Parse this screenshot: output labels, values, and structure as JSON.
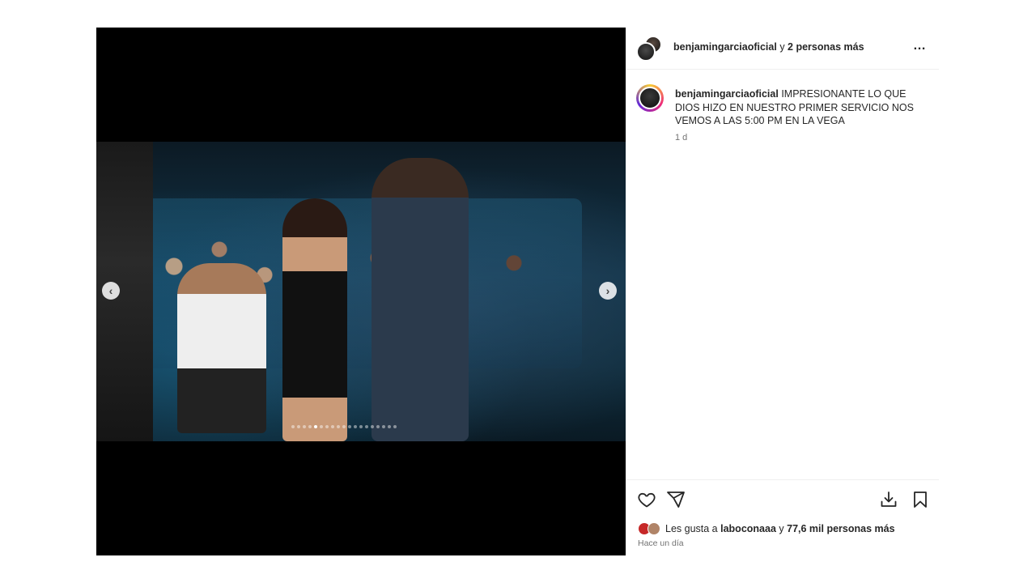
{
  "header": {
    "username": "benjamingarciaoficial",
    "connector": "y",
    "others": "2 personas más",
    "more_icon": "…"
  },
  "caption": {
    "username": "benjamingarciaoficial",
    "text": "IMPRESIONANTE LO QUE DIOS HIZO EN NUESTRO PRIMER SERVICIO NOS VEMOS A LAS 5:00 PM EN LA VEGA",
    "age": "1 d"
  },
  "media": {
    "prev_glyph": "‹",
    "next_glyph": "›",
    "carousel_total": 19,
    "carousel_active_index": 4
  },
  "actions": {
    "icons": [
      "heart-icon",
      "share-icon",
      "download-icon",
      "bookmark-icon"
    ]
  },
  "likes": {
    "prefix": "Les gusta a",
    "liker": "laboconaaa",
    "connector": "y",
    "others": "77,6 mil personas más"
  },
  "timestamp": "Hace un día"
}
